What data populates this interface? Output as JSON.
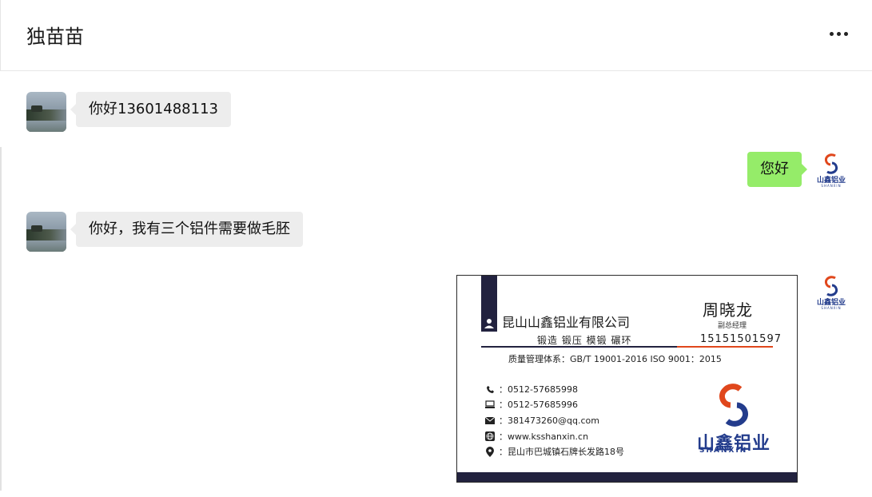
{
  "chat": {
    "title": "独苗苗"
  },
  "messages": [
    {
      "from": "contact",
      "text": "你好13601488113"
    },
    {
      "from": "me",
      "text": "您好"
    },
    {
      "from": "contact",
      "text": "你好，我有三个铝件需要做毛胚"
    }
  ],
  "my_avatar": {
    "brand": "山鑫铝业",
    "sub": "SHANXIN"
  },
  "business_card": {
    "company": "昆山山鑫铝业有限公司",
    "services": "锻造  锻压  模锻  碾环",
    "name": "周晓龙",
    "role": "副总经理",
    "mobile": "15151501597",
    "quality": "质量管理体系：GB/T 19001-2016   ISO 9001：2015",
    "tel": "：0512-57685998",
    "fax": "：0512-57685996",
    "email": "：381473260@qq.com",
    "web": "：www.ksshanxin.cn",
    "address": "：昆山市巴城镇石牌长发路18号",
    "brand": "山鑫铝业",
    "brand_sub": "SHANXIN",
    "colors": {
      "navy": "#22223f",
      "orange": "#e0471c",
      "brand_blue": "#233c8c"
    }
  },
  "colors": {
    "incoming_bubble": "#ededed",
    "outgoing_bubble": "#95ec69"
  }
}
